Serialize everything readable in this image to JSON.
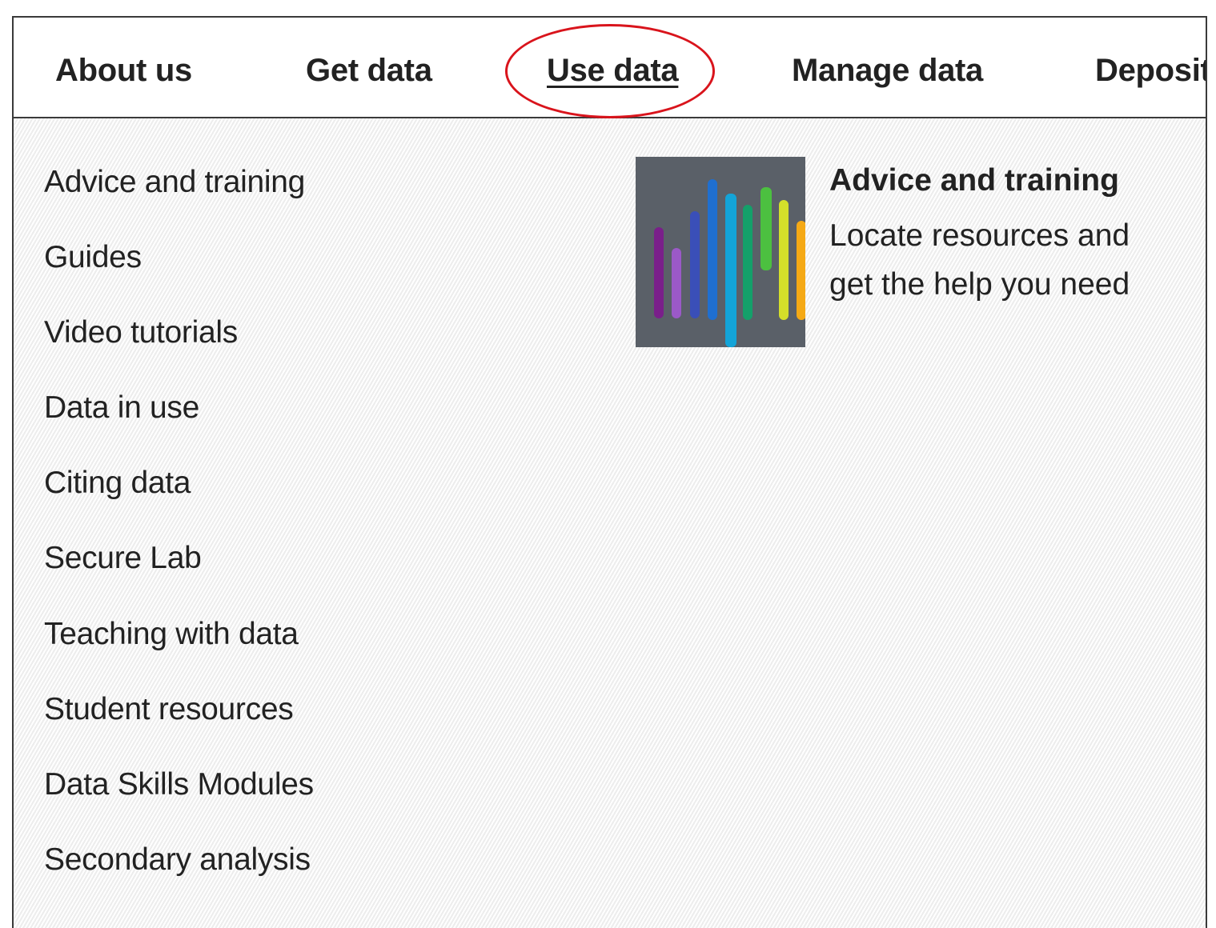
{
  "nav": {
    "items": [
      {
        "label": "About us",
        "active": false
      },
      {
        "label": "Get data",
        "active": false
      },
      {
        "label": "Use data",
        "active": true
      },
      {
        "label": "Manage data",
        "active": false
      },
      {
        "label": "Deposit",
        "active": false
      }
    ]
  },
  "menu": {
    "items": [
      {
        "label": "Advice and training"
      },
      {
        "label": "Guides"
      },
      {
        "label": "Video tutorials"
      },
      {
        "label": "Data in use"
      },
      {
        "label": "Citing data"
      },
      {
        "label": "Secure Lab"
      },
      {
        "label": "Teaching with data"
      },
      {
        "label": "Student resources"
      },
      {
        "label": "Data Skills Modules"
      },
      {
        "label": "Secondary analysis"
      }
    ]
  },
  "feature": {
    "title": "Advice and training",
    "description_line1": "Locate resources and",
    "description_line2": "get the help you need",
    "image": "colored-bars-thumbnail"
  },
  "colors": {
    "highlight": "#d9141c",
    "text": "#222222",
    "thumbnail_bg": "#5a6068"
  }
}
